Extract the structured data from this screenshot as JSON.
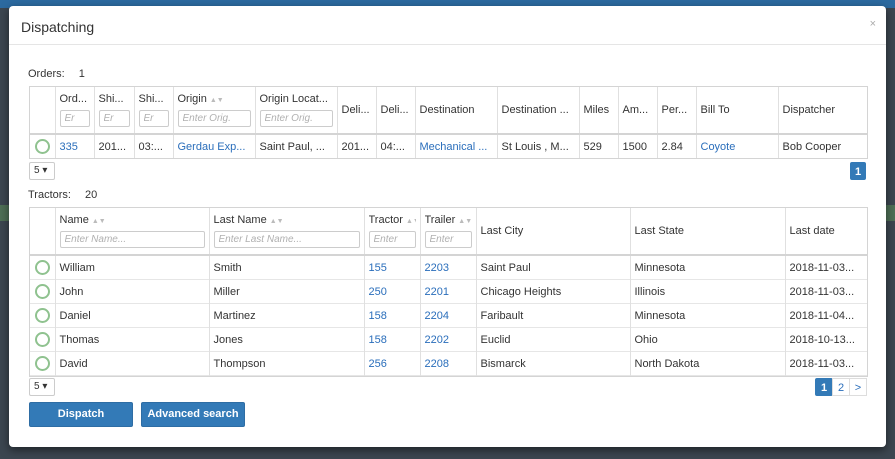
{
  "modal": {
    "title": "Dispatching",
    "close": "×"
  },
  "orders": {
    "label": "Orders:",
    "count": "1",
    "columns": [
      {
        "label": "Ord...",
        "filter": "Er"
      },
      {
        "label": "Shi...",
        "filter": "Er"
      },
      {
        "label": "Shi...",
        "filter": "Er"
      },
      {
        "label": "Origin",
        "filter": "Enter Orig."
      },
      {
        "label": "Origin Locat...",
        "filter": "Enter Orig."
      },
      {
        "label": "Deli..."
      },
      {
        "label": "Deli..."
      },
      {
        "label": "Destination"
      },
      {
        "label": "Destination ..."
      },
      {
        "label": "Miles"
      },
      {
        "label": "Am..."
      },
      {
        "label": "Per..."
      },
      {
        "label": "Bill To"
      },
      {
        "label": "Dispatcher"
      }
    ],
    "rows": [
      [
        "335",
        "201...",
        "03:...",
        "Gerdau Exp...",
        "Saint Paul, ...",
        "201...",
        "04:...",
        "Mechanical ...",
        "St Louis , M...",
        "529",
        "1500",
        "2.84",
        "Coyote",
        "Bob Cooper"
      ]
    ],
    "page_size": "5 ▾",
    "pages": [
      "1"
    ]
  },
  "tractors": {
    "label": "Tractors:",
    "count": "20",
    "columns": [
      {
        "label": "Name",
        "filter": "Enter Name..."
      },
      {
        "label": "Last Name",
        "filter": "Enter Last Name..."
      },
      {
        "label": "Tractor",
        "filter": "Enter"
      },
      {
        "label": "Trailer",
        "filter": "Enter"
      },
      {
        "label": "Last City"
      },
      {
        "label": "Last State"
      },
      {
        "label": "Last date"
      }
    ],
    "rows": [
      [
        "William",
        "Smith",
        "155",
        "2203",
        "Saint Paul",
        "Minnesota",
        "2018-11-03..."
      ],
      [
        "John",
        "Miller",
        "250",
        "2201",
        "Chicago Heights",
        "Illinois",
        "2018-11-03..."
      ],
      [
        "Daniel",
        "Martinez",
        "158",
        "2204",
        "Faribault",
        "Minnesota",
        "2018-11-04..."
      ],
      [
        "Thomas",
        "Jones",
        "158",
        "2202",
        "Euclid",
        "Ohio",
        "2018-10-13..."
      ],
      [
        "David",
        "Thompson",
        "256",
        "2208",
        "Bismarck",
        "North Dakota",
        "2018-11-03..."
      ]
    ],
    "page_size": "5 ▾",
    "pages": [
      "1",
      "2",
      ">"
    ]
  },
  "buttons": {
    "dispatch": "Dispatch",
    "advanced_search": "Advanced search"
  },
  "colors": {
    "primary": "#337ab7",
    "link": "#2a6ebb",
    "radio": "#8fc28f"
  },
  "icons": {
    "sort": "sort-arrows-icon",
    "close": "close-icon",
    "caret": "caret-down-icon"
  }
}
